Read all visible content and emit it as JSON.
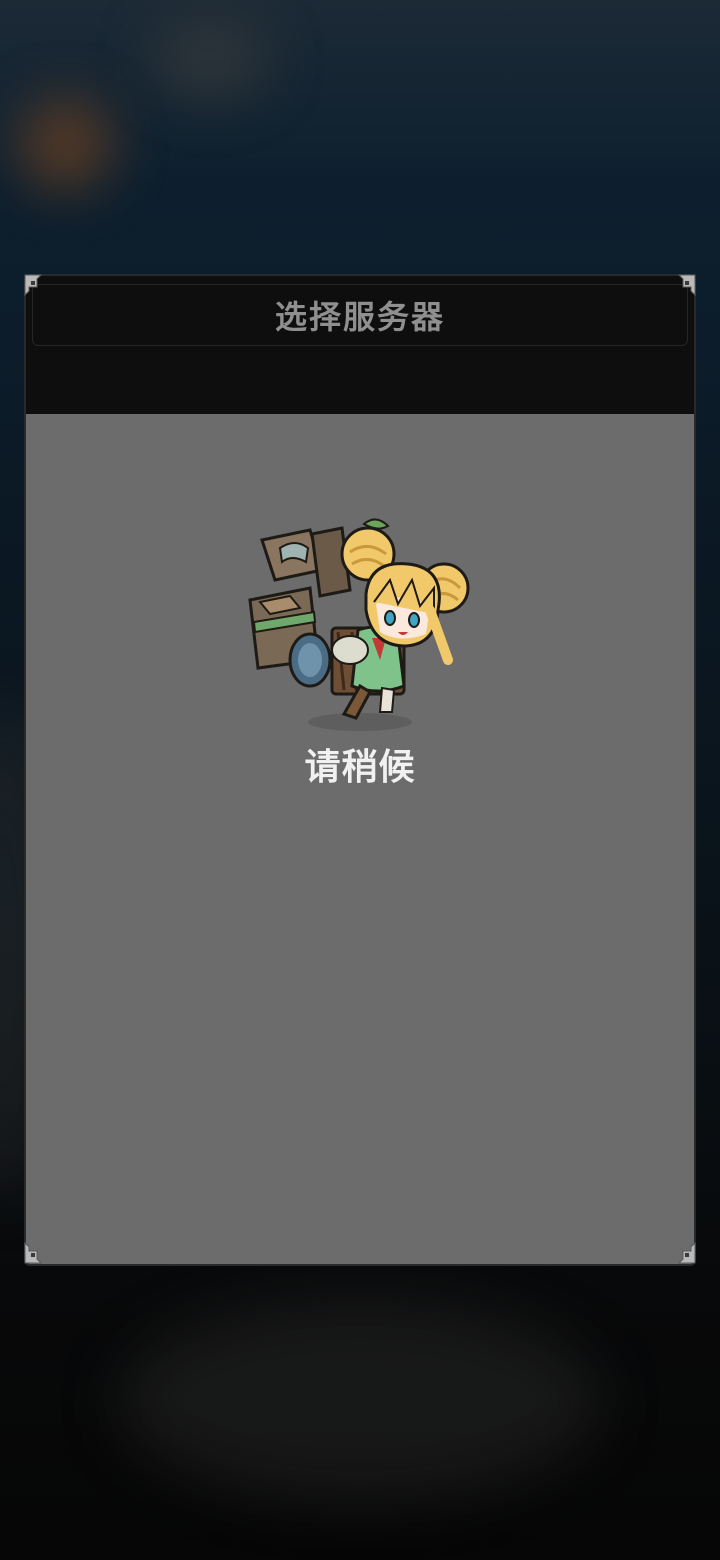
{
  "dialog": {
    "title": "选择服务器"
  },
  "loading": {
    "message": "请稍候",
    "mascot_icon": "merchant-girl-with-backpack"
  }
}
